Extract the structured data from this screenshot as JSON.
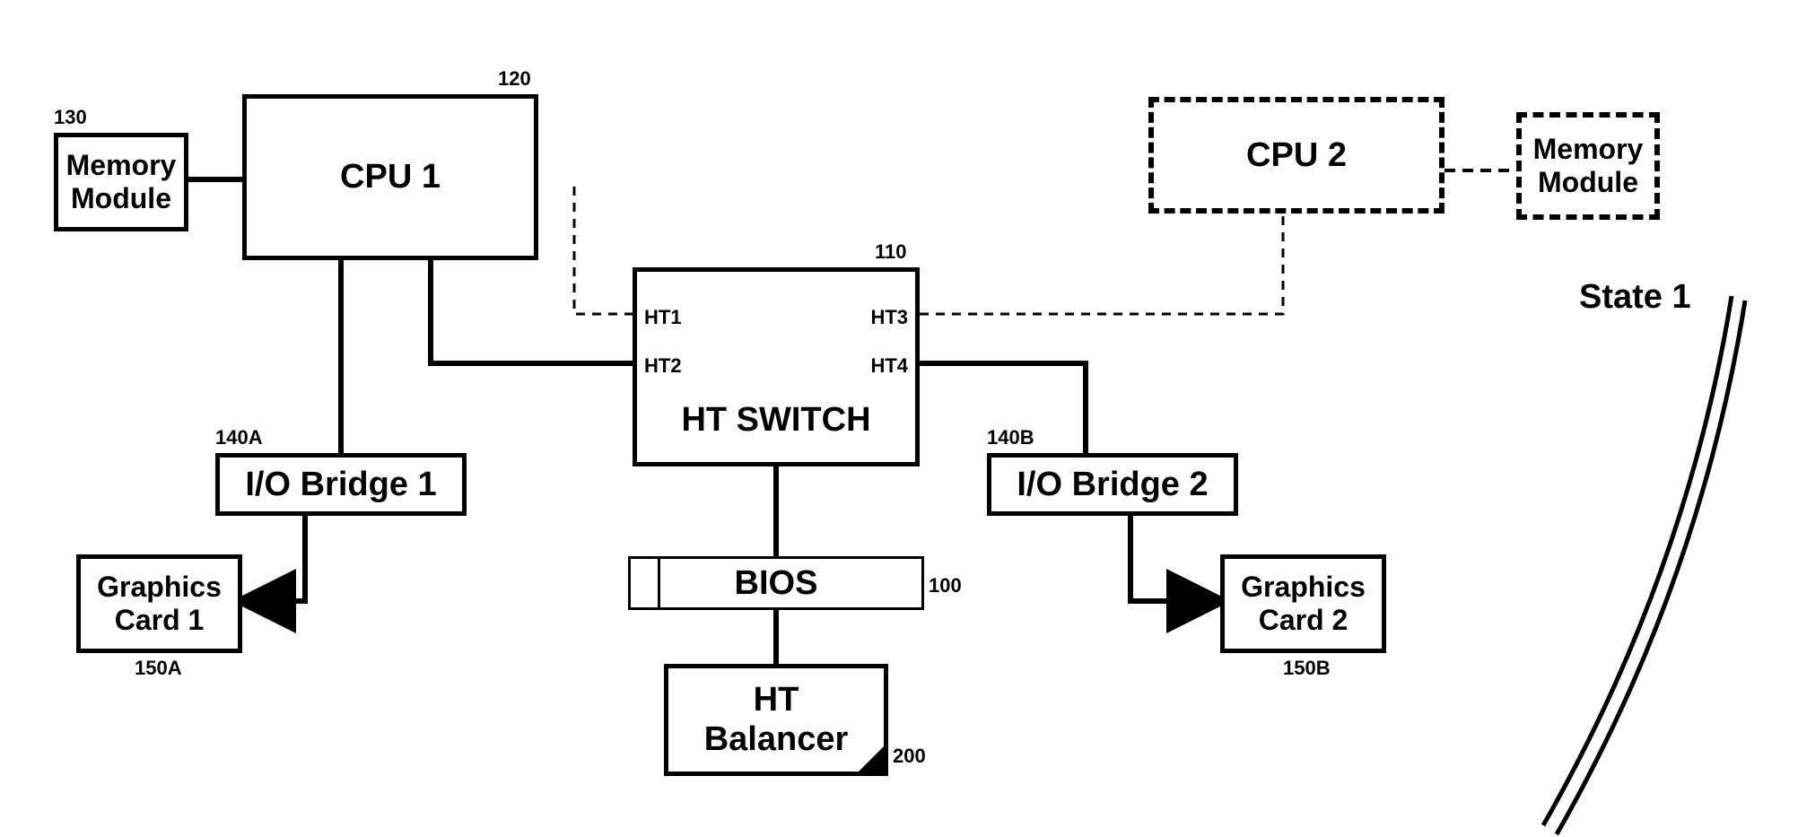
{
  "state_label": "State 1",
  "blocks": {
    "memory1": {
      "ref": "130",
      "label": "Memory\nModule"
    },
    "cpu1": {
      "ref": "120",
      "label": "CPU 1"
    },
    "cpu2": {
      "label": "CPU 2"
    },
    "memory2": {
      "label": "Memory\nModule"
    },
    "htswitch": {
      "ref": "110",
      "label": "HT SWITCH"
    },
    "iobridge1": {
      "ref": "140A",
      "label": "I/O Bridge 1"
    },
    "iobridge2": {
      "ref": "140B",
      "label": "I/O Bridge 2"
    },
    "graphics1": {
      "ref": "150A",
      "label": "Graphics\nCard 1"
    },
    "graphics2": {
      "ref": "150B",
      "label": "Graphics\nCard 2"
    },
    "bios": {
      "ref": "100",
      "label": "BIOS"
    },
    "balancer": {
      "ref": "200",
      "label": "HT\nBalancer"
    }
  },
  "ports": {
    "ht1": "HT1",
    "ht2": "HT2",
    "ht3": "HT3",
    "ht4": "HT4"
  }
}
